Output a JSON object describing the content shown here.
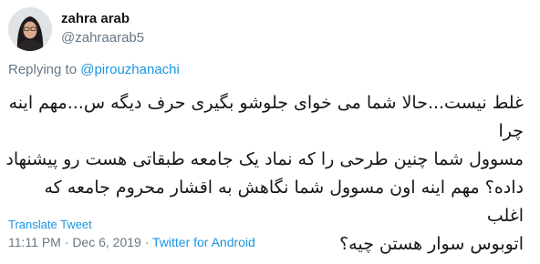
{
  "user": {
    "display_name": "zahra arab",
    "handle": "@zahraarab5",
    "avatar_icon": "profile-photo-woman-hijab"
  },
  "reply": {
    "prefix": "Replying to ",
    "mention": "@pirouzhanachi"
  },
  "tweet": {
    "text": "غلط نیست...حالا شما می خوای جلوشو بگیری حرف دیگه س...مهم اینه چرا\nمسوول شما چنین طرحی را که نماد یک جامعه  طبقاتی هست رو پیشنهاد\nداده؟ مهم اینه اون مسوول شما نگاهش به اقشار محروم جامعه که اغلب\nاتوبوس سوار هستن چیه؟"
  },
  "translate_label": "Translate Tweet",
  "meta": {
    "time": "11:11 PM",
    "separator": " · ",
    "date": "Dec 6, 2019",
    "separator2": " · ",
    "client": "Twitter for Android"
  },
  "colors": {
    "link": "#1b95e0",
    "secondary_text": "#657786",
    "primary_text": "#14171a"
  }
}
